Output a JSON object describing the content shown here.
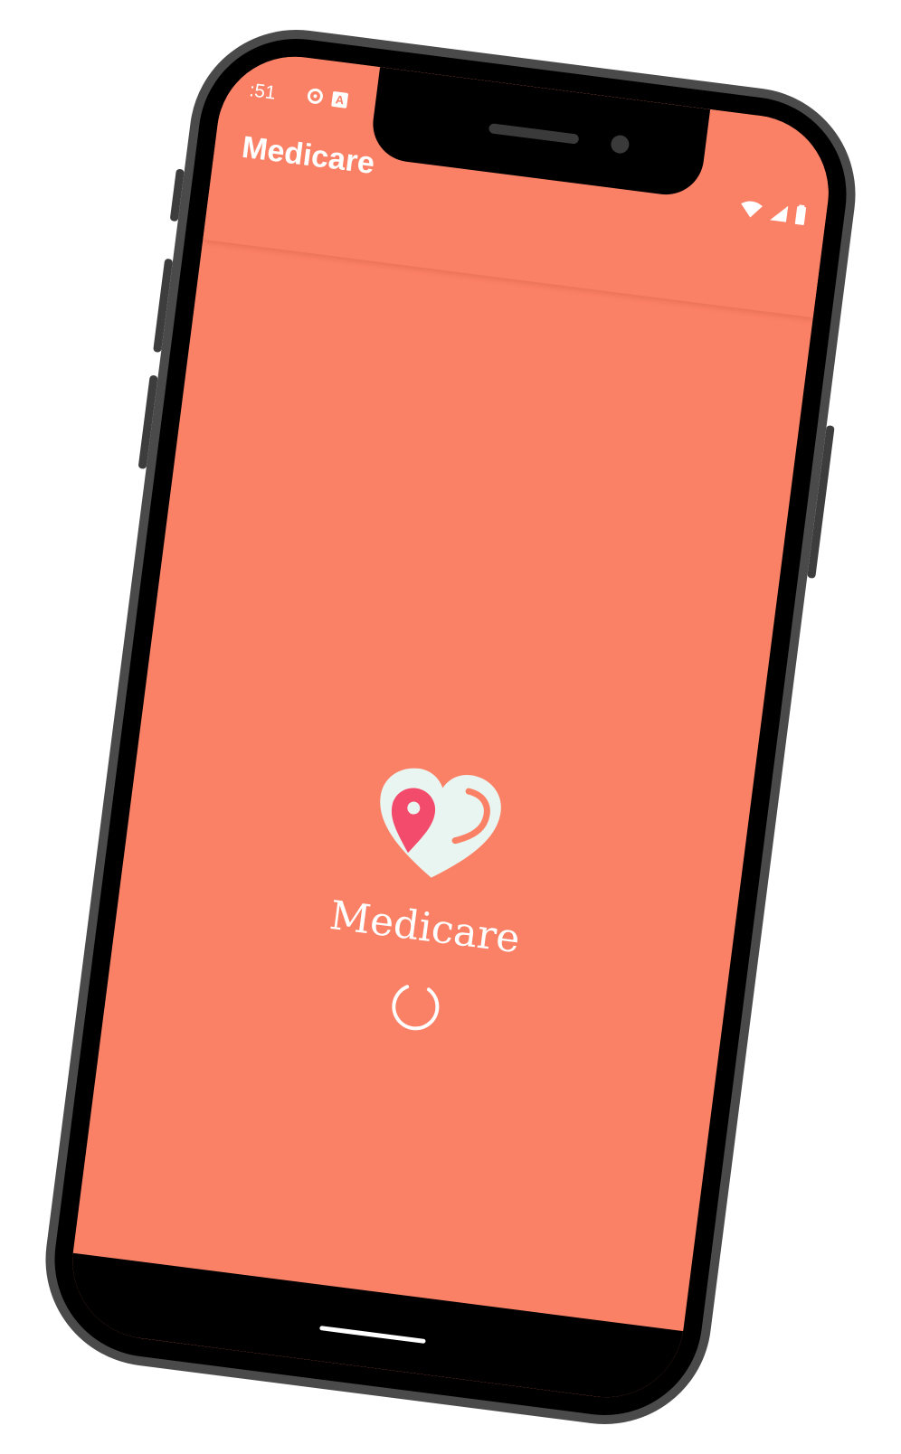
{
  "status_bar": {
    "time": ":51",
    "icons_left": [
      "notification-icon",
      "app-a-icon"
    ],
    "icons_right": [
      "wifi-icon",
      "signal-icon",
      "battery-icon"
    ],
    "a_badge": "A"
  },
  "app_bar": {
    "title": "Medicare"
  },
  "splash": {
    "logo_icon": "heart-location-pin-icon",
    "brand_name": "Medicare",
    "loading_indicator": "spinner-icon"
  },
  "colors": {
    "primary": "#fb8166",
    "logo_heart": "#e9f5f0",
    "logo_pin": "#f34b6b",
    "text": "#ffffff"
  }
}
